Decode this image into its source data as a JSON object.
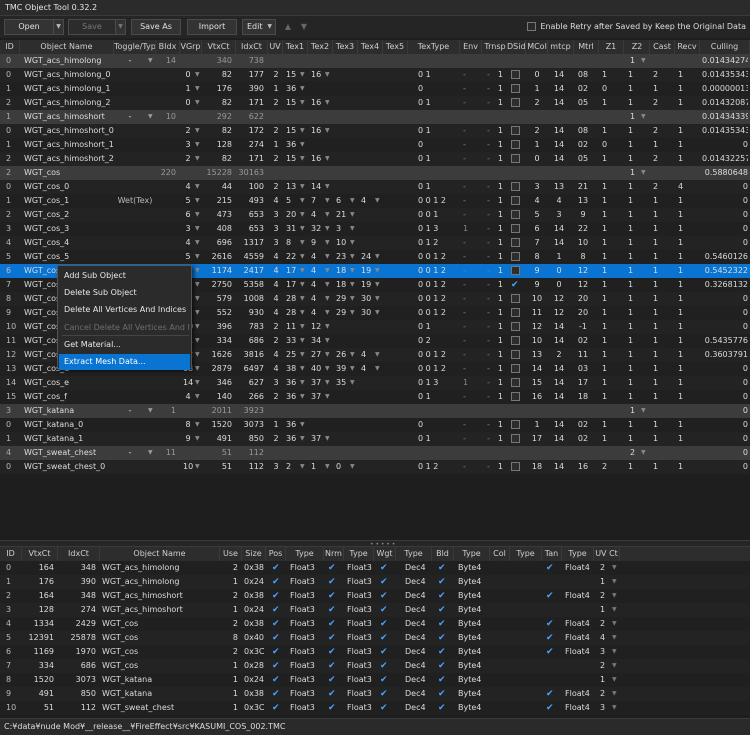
{
  "window": {
    "title": "TMC Object Tool 0.32.2"
  },
  "toolbar": {
    "open": "Open",
    "save": "Save",
    "save_as": "Save As",
    "import": "Import",
    "edit": "Edit",
    "up": "▲",
    "down": "▼",
    "retry_label": "Enable Retry after Saved by Keep the Original Data"
  },
  "top_table": {
    "columns": [
      "ID",
      "Object Name",
      "Toggle/Type",
      "BIdx",
      "VGrp",
      "VtxCt",
      "IdxCt",
      "UV",
      "Tex1",
      "Tex2",
      "Tex3",
      "Tex4",
      "Tex5",
      "TexType",
      "Env",
      "Trnsp",
      "DSid",
      "MCol",
      "mtcp",
      "Mtrl",
      "Z1",
      "Z2",
      "Cast",
      "Recv",
      "Culling"
    ],
    "groups": [
      {
        "id": "0",
        "name": "WGT_acs_himolong",
        "toggle": "-",
        "bidx": "14",
        "vtx": "340",
        "idx": "738",
        "z1": "1",
        "culling": "0.01434274"
      },
      {
        "id": "1",
        "name": "WGT_acs_himoshort",
        "toggle": "-",
        "bidx": "10",
        "vtx": "292",
        "idx": "622",
        "z1": "1",
        "culling": "0.01434339"
      },
      {
        "id": "2",
        "name": "WGT_cos",
        "toggle": "",
        "bidx": "220",
        "vtx": "15228",
        "idx": "30163",
        "z1": "1",
        "culling": "0.5880648"
      },
      {
        "id": "3",
        "name": "WGT_katana",
        "toggle": "-",
        "bidx": "1",
        "vtx": "2011",
        "idx": "3923",
        "z1": "1",
        "culling": "0"
      },
      {
        "id": "4",
        "name": "WGT_sweat_chest",
        "toggle": "-",
        "bidx": "11",
        "vtx": "51",
        "idx": "112",
        "z1": "2",
        "culling": "0"
      }
    ],
    "rows": [
      {
        "id": "0",
        "name": "WGT_acs_himolong_0",
        "vgrp": "0",
        "vtx": "82",
        "idx": "177",
        "uv": "2",
        "t1": "15",
        "t2": "16",
        "t3": "",
        "textype": "0 1",
        "env": "-",
        "trnsp": "1",
        "mcol": "0",
        "mtcp": "14",
        "mtrl": "08",
        "z1": "1",
        "z2": "1",
        "cast": "2",
        "recv": "1",
        "culling": "0.01435343"
      },
      {
        "id": "1",
        "name": "WGT_acs_himolong_1",
        "vgrp": "1",
        "vtx": "176",
        "idx": "390",
        "uv": "1",
        "t1": "36",
        "t2": "",
        "t3": "",
        "textype": "0",
        "env": "-",
        "trnsp": "1",
        "mcol": "1",
        "mtcp": "14",
        "mtrl": "02",
        "z1": "0",
        "z2": "1",
        "cast": "1",
        "recv": "1",
        "culling": "0.00000013"
      },
      {
        "id": "2",
        "name": "WGT_acs_himolong_2",
        "vgrp": "0",
        "vtx": "82",
        "idx": "171",
        "uv": "2",
        "t1": "15",
        "t2": "16",
        "t3": "",
        "textype": "0 1",
        "env": "-",
        "trnsp": "1",
        "mcol": "2",
        "mtcp": "14",
        "mtrl": "05",
        "z1": "1",
        "z2": "1",
        "cast": "2",
        "recv": "1",
        "culling": "0.01432087"
      },
      {
        "id": "0",
        "name": "WGT_acs_himoshort_0",
        "vgrp": "2",
        "vtx": "82",
        "idx": "172",
        "uv": "2",
        "t1": "15",
        "t2": "16",
        "t3": "",
        "textype": "0 1",
        "env": "-",
        "trnsp": "1",
        "mcol": "2",
        "mtcp": "14",
        "mtrl": "08",
        "z1": "1",
        "z2": "1",
        "cast": "2",
        "recv": "1",
        "culling": "0.01435343"
      },
      {
        "id": "1",
        "name": "WGT_acs_himoshort_1",
        "vgrp": "3",
        "vtx": "128",
        "idx": "274",
        "uv": "1",
        "t1": "36",
        "t2": "",
        "t3": "",
        "textype": "0",
        "env": "-",
        "trnsp": "1",
        "mcol": "1",
        "mtcp": "14",
        "mtrl": "02",
        "z1": "0",
        "z2": "1",
        "cast": "1",
        "recv": "1",
        "culling": "0"
      },
      {
        "id": "2",
        "name": "WGT_acs_himoshort_2",
        "vgrp": "2",
        "vtx": "82",
        "idx": "171",
        "uv": "2",
        "t1": "15",
        "t2": "16",
        "t3": "",
        "textype": "0 1",
        "env": "-",
        "trnsp": "1",
        "mcol": "0",
        "mtcp": "14",
        "mtrl": "05",
        "z1": "1",
        "z2": "1",
        "cast": "2",
        "recv": "1",
        "culling": "0.01432257"
      },
      {
        "id": "0",
        "name": "WGT_cos_0",
        "vgrp": "4",
        "vtx": "44",
        "idx": "100",
        "uv": "2",
        "t1": "13",
        "t2": "14",
        "t3": "",
        "textype": "0 1",
        "env": "-",
        "trnsp": "1",
        "mcol": "3",
        "mtcp": "13",
        "mtrl": "21",
        "z1": "1",
        "z2": "1",
        "cast": "2",
        "recv": "4",
        "culling": "0"
      },
      {
        "id": "1",
        "name": "WGT_cos_1",
        "toggle": "Wet(Tex)",
        "vgrp": "5",
        "vtx": "215",
        "idx": "493",
        "uv": "4",
        "t1": "5",
        "t2": "7",
        "t3": "6",
        "t4": "4",
        "textype": "0 0 1 2",
        "env": "-",
        "trnsp": "1",
        "mcol": "4",
        "mtcp": "4",
        "mtrl": "13",
        "z1": "1",
        "z2": "1",
        "cast": "1",
        "recv": "1",
        "culling": "0"
      },
      {
        "id": "2",
        "name": "WGT_cos_2",
        "vgrp": "6",
        "vtx": "473",
        "idx": "653",
        "uv": "3",
        "t1": "20",
        "t2": "4",
        "t3": "21",
        "t4": "",
        "textype": "0 0 1",
        "env": "-",
        "trnsp": "1",
        "mcol": "5",
        "mtcp": "3",
        "mtrl": "9",
        "z1": "1",
        "z2": "1",
        "cast": "1",
        "recv": "1",
        "culling": "0"
      },
      {
        "id": "3",
        "name": "WGT_cos_3",
        "vgrp": "3",
        "vtx": "408",
        "idx": "653",
        "uv": "3",
        "t1": "31",
        "t2": "32",
        "t3": "3",
        "t4": "",
        "textype": "0 1 3",
        "env": "1",
        "trnsp": "1",
        "mcol": "6",
        "mtcp": "14",
        "mtrl": "22",
        "z1": "1",
        "z2": "1",
        "cast": "1",
        "recv": "1",
        "culling": "0"
      },
      {
        "id": "4",
        "name": "WGT_cos_4",
        "vgrp": "4",
        "vtx": "696",
        "idx": "1317",
        "uv": "3",
        "t1": "8",
        "t2": "9",
        "t3": "10",
        "t4": "",
        "textype": "0 1 2",
        "env": "-",
        "trnsp": "1",
        "mcol": "7",
        "mtcp": "14",
        "mtrl": "10",
        "z1": "1",
        "z2": "1",
        "cast": "1",
        "recv": "1",
        "culling": "0"
      },
      {
        "id": "5",
        "name": "WGT_cos_5",
        "vgrp": "5",
        "vtx": "2616",
        "idx": "4559",
        "uv": "4",
        "t1": "22",
        "t2": "4",
        "t3": "23",
        "t4": "24",
        "textype": "0 0 1 2",
        "env": "-",
        "trnsp": "1",
        "mcol": "8",
        "mtcp": "1",
        "mtrl": "8",
        "z1": "1",
        "z2": "1",
        "cast": "1",
        "recv": "1",
        "culling": "0.5460126"
      },
      {
        "id": "6",
        "name": "WGT_cos_6",
        "vgrp": "6",
        "vtx": "1174",
        "idx": "2417",
        "uv": "4",
        "t1": "17",
        "t2": "4",
        "t3": "18",
        "t4": "19",
        "textype": "0 0 1 2",
        "env": "-",
        "trnsp": "1",
        "mcol": "9",
        "mtcp": "0",
        "mtrl": "12",
        "z1": "1",
        "z2": "1",
        "cast": "1",
        "recv": "1",
        "culling": "0.5452322",
        "selected": true
      },
      {
        "id": "7",
        "name": "WGT_cos_7",
        "vgrp": "7",
        "vtx": "2750",
        "idx": "5358",
        "uv": "4",
        "t1": "17",
        "t2": "4",
        "t3": "18",
        "t4": "19",
        "textype": "0 0 1 2",
        "env": "-",
        "trnsp": "1",
        "mcol": "9",
        "mtcp": "0",
        "mtrl": "12",
        "z1": "1",
        "z2": "1",
        "cast": "1",
        "recv": "1",
        "culling": "0.3268132",
        "dsid": true
      },
      {
        "id": "8",
        "name": "WGT_cos_8",
        "vgrp": "8",
        "vtx": "579",
        "idx": "1008",
        "uv": "4",
        "t1": "28",
        "t2": "4",
        "t3": "29",
        "t4": "30",
        "textype": "0 0 1 2",
        "env": "-",
        "trnsp": "1",
        "mcol": "10",
        "mtcp": "12",
        "mtrl": "20",
        "z1": "1",
        "z2": "1",
        "cast": "1",
        "recv": "1",
        "culling": "0"
      },
      {
        "id": "9",
        "name": "WGT_cos_9",
        "vgrp": "9",
        "vtx": "552",
        "idx": "930",
        "uv": "4",
        "t1": "28",
        "t2": "4",
        "t3": "29",
        "t4": "30",
        "textype": "0 0 1 2",
        "env": "-",
        "trnsp": "1",
        "mcol": "11",
        "mtcp": "12",
        "mtrl": "20",
        "z1": "1",
        "z2": "1",
        "cast": "1",
        "recv": "1",
        "culling": "0"
      },
      {
        "id": "10",
        "name": "WGT_cos_a",
        "vgrp": "10",
        "vtx": "396",
        "idx": "783",
        "uv": "2",
        "t1": "11",
        "t2": "12",
        "t3": "",
        "t4": "",
        "textype": "0 1",
        "env": "-",
        "trnsp": "1",
        "mcol": "12",
        "mtcp": "14",
        "mtrl": "-1",
        "z1": "1",
        "z2": "1",
        "cast": "1",
        "recv": "1",
        "culling": "0"
      },
      {
        "id": "11",
        "name": "WGT_cos_b",
        "vgrp": "11",
        "vtx": "334",
        "idx": "686",
        "uv": "2",
        "t1": "33",
        "t2": "34",
        "t3": "",
        "t4": "",
        "textype": "0 2",
        "env": "-",
        "trnsp": "1",
        "mcol": "10",
        "mtcp": "14",
        "mtrl": "02",
        "z1": "1",
        "z2": "1",
        "cast": "1",
        "recv": "1",
        "culling": "0.5435776"
      },
      {
        "id": "12",
        "name": "WGT_cos_c",
        "vgrp": "12",
        "vtx": "1626",
        "idx": "3816",
        "uv": "4",
        "t1": "25",
        "t2": "27",
        "t3": "26",
        "t4": "4",
        "textype": "0 0 1 2",
        "env": "-",
        "trnsp": "1",
        "mcol": "13",
        "mtcp": "2",
        "mtrl": "11",
        "z1": "1",
        "z2": "1",
        "cast": "1",
        "recv": "1",
        "culling": "0.3603791"
      },
      {
        "id": "13",
        "name": "WGT_cos_d",
        "vgrp": "13",
        "vtx": "2879",
        "idx": "6497",
        "uv": "4",
        "t1": "38",
        "t2": "40",
        "t3": "39",
        "t4": "4",
        "textype": "0 0 1 2",
        "env": "-",
        "trnsp": "1",
        "mcol": "14",
        "mtcp": "14",
        "mtrl": "03",
        "z1": "1",
        "z2": "1",
        "cast": "1",
        "recv": "1",
        "culling": "0"
      },
      {
        "id": "14",
        "name": "WGT_cos_e",
        "vgrp": "14",
        "vtx": "346",
        "idx": "627",
        "uv": "3",
        "t1": "36",
        "t2": "37",
        "t3": "35",
        "t4": "",
        "textype": "0 1 3",
        "env": "1",
        "trnsp": "1",
        "mcol": "15",
        "mtcp": "14",
        "mtrl": "17",
        "z1": "1",
        "z2": "1",
        "cast": "1",
        "recv": "1",
        "culling": "0"
      },
      {
        "id": "15",
        "name": "WGT_cos_f",
        "vgrp": "4",
        "vtx": "140",
        "idx": "266",
        "uv": "2",
        "t1": "36",
        "t2": "37",
        "t3": "",
        "t4": "",
        "textype": "0 1",
        "env": "-",
        "trnsp": "1",
        "mcol": "16",
        "mtcp": "14",
        "mtrl": "18",
        "z1": "1",
        "z2": "1",
        "cast": "1",
        "recv": "1",
        "culling": "0"
      },
      {
        "id": "0",
        "name": "WGT_katana_0",
        "vgrp": "8",
        "vtx": "1520",
        "idx": "3073",
        "uv": "1",
        "t1": "36",
        "t2": "",
        "t3": "",
        "t4": "",
        "textype": "0",
        "env": "-",
        "trnsp": "1",
        "mcol": "1",
        "mtcp": "14",
        "mtrl": "02",
        "z1": "1",
        "z2": "1",
        "cast": "1",
        "recv": "1",
        "culling": "0"
      },
      {
        "id": "1",
        "name": "WGT_katana_1",
        "vgrp": "9",
        "vtx": "491",
        "idx": "850",
        "uv": "2",
        "t1": "36",
        "t2": "37",
        "t3": "",
        "t4": "",
        "textype": "0 1",
        "env": "-",
        "trnsp": "1",
        "mcol": "17",
        "mtcp": "14",
        "mtrl": "02",
        "z1": "1",
        "z2": "1",
        "cast": "1",
        "recv": "1",
        "culling": "0"
      },
      {
        "id": "0",
        "name": "WGT_sweat_chest_0",
        "vgrp": "10",
        "vtx": "51",
        "idx": "112",
        "uv": "3",
        "t1": "2",
        "t2": "1",
        "t3": "0",
        "t4": "",
        "textype": "0 1 2",
        "env": "-",
        "trnsp": "1",
        "mcol": "18",
        "mtcp": "14",
        "mtrl": "16",
        "z1": "2",
        "z2": "1",
        "cast": "1",
        "recv": "1",
        "culling": "0"
      }
    ]
  },
  "context_menu": {
    "items": [
      {
        "label": "Add Sub Object",
        "enabled": true
      },
      {
        "label": "Delete Sub Object",
        "enabled": true
      },
      {
        "label": "Delete All Vertices And Indices",
        "enabled": true
      },
      {
        "label": "Cancel Delete All Vertices And Indices",
        "enabled": false
      },
      {
        "label": "Get Material...",
        "enabled": true
      },
      {
        "label": "Extract Mesh Data...",
        "enabled": true,
        "highlighted": true
      }
    ]
  },
  "bottom_table": {
    "columns": [
      "ID",
      "VtxCt",
      "IdxCt",
      "Object Name",
      "Use",
      "Size",
      "Pos",
      "Type",
      "Nrm",
      "Type",
      "Wgt",
      "Type",
      "Bld",
      "Type",
      "Col",
      "Type",
      "Tan",
      "Type",
      "UV Ct"
    ],
    "rows": [
      {
        "id": "0",
        "vtx": "164",
        "idx": "348",
        "name": "WGT_acs_himolong",
        "use": "2",
        "size": "0x38",
        "tan": true,
        "tantype": "Float4",
        "uv": "2"
      },
      {
        "id": "1",
        "vtx": "176",
        "idx": "390",
        "name": "WGT_acs_himolong",
        "use": "1",
        "size": "0x24",
        "tan": false,
        "tantype": "",
        "uv": "1"
      },
      {
        "id": "2",
        "vtx": "164",
        "idx": "348",
        "name": "WGT_acs_himoshort",
        "use": "2",
        "size": "0x38",
        "tan": true,
        "tantype": "Float4",
        "uv": "2"
      },
      {
        "id": "3",
        "vtx": "128",
        "idx": "274",
        "name": "WGT_acs_himoshort",
        "use": "1",
        "size": "0x24",
        "tan": false,
        "tantype": "",
        "uv": "1"
      },
      {
        "id": "4",
        "vtx": "1334",
        "idx": "2429",
        "name": "WGT_cos",
        "use": "2",
        "size": "0x38",
        "tan": true,
        "tantype": "Float4",
        "uv": "2"
      },
      {
        "id": "5",
        "vtx": "12391",
        "idx": "25878",
        "name": "WGT_cos",
        "use": "8",
        "size": "0x40",
        "tan": true,
        "tantype": "Float4",
        "uv": "4"
      },
      {
        "id": "6",
        "vtx": "1169",
        "idx": "1970",
        "name": "WGT_cos",
        "use": "2",
        "size": "0x3C",
        "tan": true,
        "tantype": "Float4",
        "uv": "3"
      },
      {
        "id": "7",
        "vtx": "334",
        "idx": "686",
        "name": "WGT_cos",
        "use": "1",
        "size": "0x28",
        "tan": false,
        "tantype": "",
        "uv": "2"
      },
      {
        "id": "8",
        "vtx": "1520",
        "idx": "3073",
        "name": "WGT_katana",
        "use": "1",
        "size": "0x24",
        "tan": false,
        "tantype": "",
        "uv": "1"
      },
      {
        "id": "9",
        "vtx": "491",
        "idx": "850",
        "name": "WGT_katana",
        "use": "1",
        "size": "0x38",
        "tan": true,
        "tantype": "Float4",
        "uv": "2"
      },
      {
        "id": "10",
        "vtx": "51",
        "idx": "112",
        "name": "WGT_sweat_chest",
        "use": "1",
        "size": "0x3C",
        "tan": true,
        "tantype": "Float4",
        "uv": "3"
      }
    ],
    "float3": "Float3",
    "dec4": "Dec4",
    "byte4": "Byte4"
  },
  "statusbar": {
    "path": "C:¥data¥nude Mod¥__release__¥FireEffect¥src¥KASUMI_COS_002.TMC"
  },
  "colors": {
    "selection": "#0a74d3",
    "group_row": "#3c3c3c",
    "check": "#4aa3ff",
    "bg": "#1e1e1e"
  }
}
